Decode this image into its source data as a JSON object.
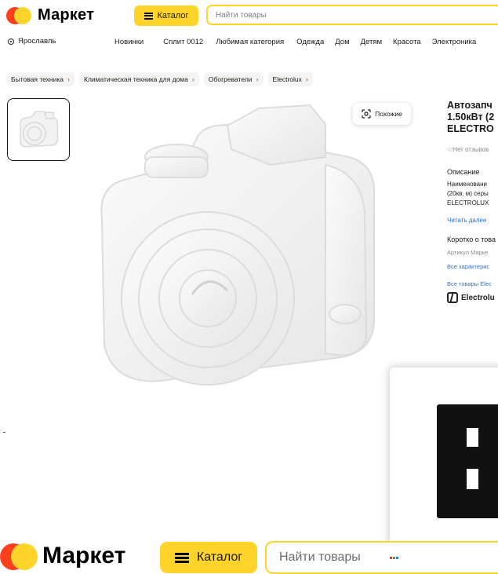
{
  "header": {
    "logo_text": "Маркет",
    "catalog_label": "Каталог",
    "search_placeholder": "Найти товары"
  },
  "nav": {
    "city": "Ярославль",
    "links": [
      "Новинки",
      "Сплит 0012",
      "Любимая категория",
      "Одежда",
      "Дом",
      "Детям",
      "Красота",
      "Электроника"
    ]
  },
  "breadcrumbs": [
    "Бытовая техника",
    "Климатическая техника для дома",
    "Обогреватели",
    "Electrolux"
  ],
  "gallery": {
    "similar_label": "Похожие"
  },
  "product": {
    "title_lines": [
      "Автозапч",
      "1.50кВт (2",
      "ELECTRO"
    ],
    "reviews": "Нет отзывов",
    "description_heading": "Описание",
    "description_lines": [
      "Наименовани",
      "(20кв. м) серы",
      "ELECTROLUX"
    ],
    "read_more": "Читать далее",
    "short_heading": "Коротко о това",
    "article": "Артикул Марке",
    "all_specs": "Все характерис",
    "all_brand": "Все товары Elec",
    "brand_name": "Electrolu"
  },
  "sticky": {
    "logo_text": "Маркет",
    "catalog_label": "Каталог",
    "search_placeholder": "Найти товары"
  },
  "colors": {
    "accent_yellow": "#fed42b",
    "brand_red": "#fc3f1d",
    "link_blue": "#2a6fdb"
  }
}
